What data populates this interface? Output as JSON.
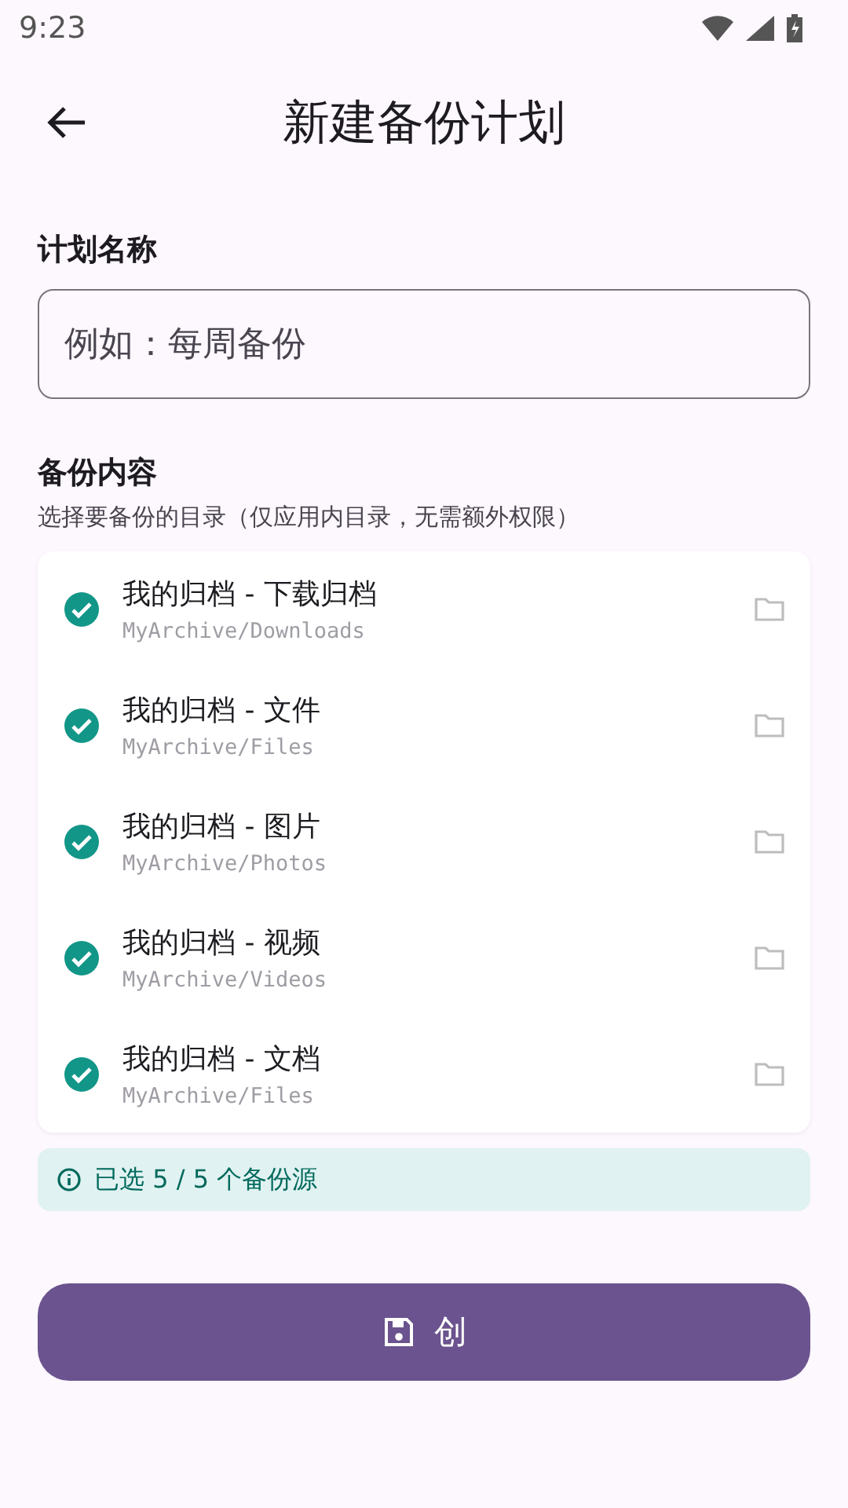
{
  "status_bar": {
    "time": "9:23"
  },
  "app_bar": {
    "title": "新建备份计划"
  },
  "plan_name": {
    "label": "计划名称",
    "placeholder": "例如：每周备份"
  },
  "backup_content": {
    "title": "备份内容",
    "subtitle": "选择要备份的目录（仅应用内目录，无需额外权限）",
    "sources": [
      {
        "name": "我的归档 - 下载归档",
        "path": "MyArchive/Downloads",
        "checked": true
      },
      {
        "name": "我的归档 - 文件",
        "path": "MyArchive/Files",
        "checked": true
      },
      {
        "name": "我的归档 - 图片",
        "path": "MyArchive/Photos",
        "checked": true
      },
      {
        "name": "我的归档 - 视频",
        "path": "MyArchive/Videos",
        "checked": true
      },
      {
        "name": "我的归档 - 文档",
        "path": "MyArchive/Files",
        "checked": true
      }
    ],
    "summary": "已选 5 / 5 个备份源"
  },
  "create_button": {
    "label": "创"
  }
}
